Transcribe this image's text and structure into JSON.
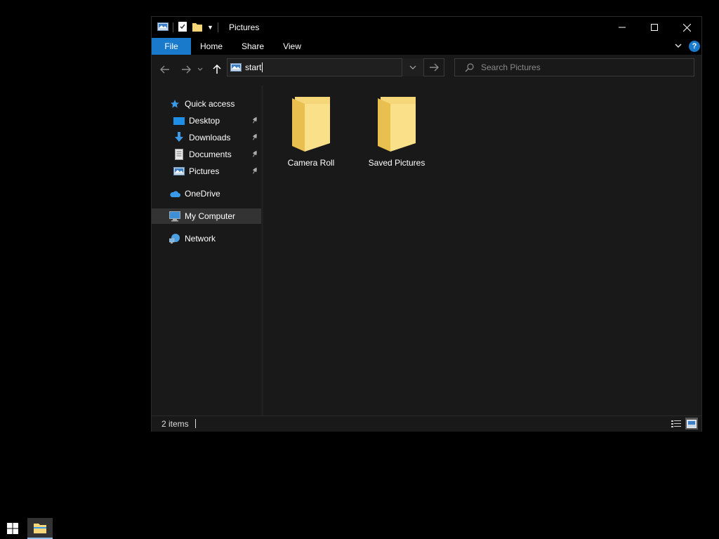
{
  "window": {
    "title": "Pictures",
    "ribbon_tabs": [
      {
        "label": "File"
      },
      {
        "label": "Home"
      },
      {
        "label": "Share"
      },
      {
        "label": "View"
      }
    ]
  },
  "address_bar": {
    "value": "start"
  },
  "search": {
    "placeholder": "Search Pictures"
  },
  "nav_pane": {
    "items": [
      {
        "label": "Quick access",
        "icon": "star-icon"
      },
      {
        "label": "Desktop",
        "icon": "desktop-icon",
        "pinned": true
      },
      {
        "label": "Downloads",
        "icon": "download-icon",
        "pinned": true
      },
      {
        "label": "Documents",
        "icon": "document-icon",
        "pinned": true
      },
      {
        "label": "Pictures",
        "icon": "pictures-icon",
        "pinned": true
      },
      {
        "label": "OneDrive",
        "icon": "cloud-icon"
      },
      {
        "label": "My Computer",
        "icon": "computer-icon",
        "selected": true
      },
      {
        "label": "Network",
        "icon": "network-icon"
      }
    ]
  },
  "content": {
    "items": [
      {
        "label": "Camera Roll",
        "icon": "folder-icon"
      },
      {
        "label": "Saved Pictures",
        "icon": "folder-icon"
      }
    ]
  },
  "status": {
    "count": "2 items"
  },
  "colors": {
    "accent": "#1979ca",
    "folder": "#f7d679",
    "background": "#191919"
  }
}
